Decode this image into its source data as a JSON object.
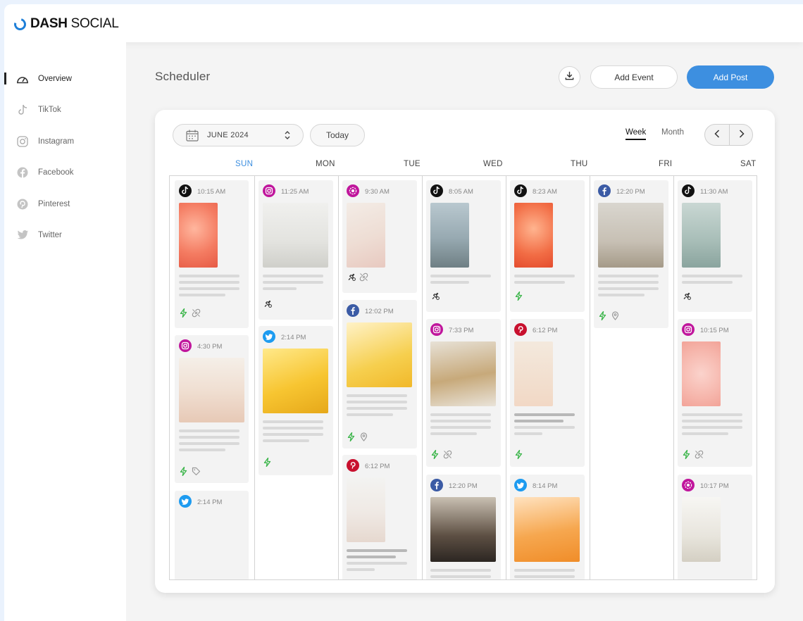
{
  "app": {
    "brand_bold": "DASH",
    "brand_light": "SOCIAL"
  },
  "sidebar": {
    "items": [
      {
        "label": "Overview",
        "icon": "dashboard-icon",
        "active": true
      },
      {
        "label": "TikTok",
        "icon": "tiktok-icon"
      },
      {
        "label": "Instagram",
        "icon": "instagram-icon"
      },
      {
        "label": "Facebook",
        "icon": "facebook-icon"
      },
      {
        "label": "Pinterest",
        "icon": "pinterest-icon"
      },
      {
        "label": "Twitter",
        "icon": "twitter-icon"
      }
    ]
  },
  "header": {
    "title": "Scheduler",
    "add_event": "Add Event",
    "add_post": "Add Post",
    "download_icon": "download-icon"
  },
  "calendar": {
    "month": "JUNE 2024",
    "today": "Today",
    "views": [
      "Week",
      "Month"
    ],
    "active_view": "Week",
    "days": [
      "SUN",
      "MON",
      "TUE",
      "WED",
      "THU",
      "FRI",
      "SAT"
    ],
    "active_day": "SUN",
    "columns": [
      [
        {
          "platform": "tiktok",
          "time": "10:15 AM",
          "actions": [
            "bolt",
            "link"
          ]
        },
        {
          "platform": "instagram",
          "time": "4:30 PM",
          "actions": [
            "bolt",
            "tag"
          ]
        },
        {
          "platform": "twitter",
          "time": "2:14 PM"
        }
      ],
      [
        {
          "platform": "instagram",
          "time": "11:25 AM",
          "actions": [
            "pin-alert"
          ]
        },
        {
          "platform": "twitter",
          "time": "2:14 PM",
          "actions": [
            "bolt"
          ]
        }
      ],
      [
        {
          "platform": "instagram-story",
          "time": "9:30 AM",
          "actions": [
            "pin-alert",
            "link"
          ]
        },
        {
          "platform": "facebook",
          "time": "12:02 PM",
          "actions": [
            "bolt",
            "location"
          ]
        },
        {
          "platform": "pinterest",
          "time": "6:12 PM"
        }
      ],
      [
        {
          "platform": "tiktok",
          "time": "8:05 AM",
          "actions": [
            "pin-alert"
          ]
        },
        {
          "platform": "instagram",
          "time": "7:33 PM",
          "actions": [
            "bolt",
            "link"
          ]
        },
        {
          "platform": "facebook",
          "time": "12:20 PM"
        }
      ],
      [
        {
          "platform": "tiktok",
          "time": "8:23 AM",
          "actions": [
            "bolt"
          ]
        },
        {
          "platform": "pinterest",
          "time": "6:12 PM",
          "actions": [
            "bolt"
          ]
        },
        {
          "platform": "twitter",
          "time": "8:14 PM"
        }
      ],
      [
        {
          "platform": "facebook",
          "time": "12:20 PM",
          "actions": [
            "bolt",
            "location"
          ]
        }
      ],
      [
        {
          "platform": "tiktok",
          "time": "11:30 AM",
          "actions": [
            "pin-alert"
          ]
        },
        {
          "platform": "instagram",
          "time": "10:15 PM",
          "actions": [
            "bolt",
            "link"
          ]
        },
        {
          "platform": "instagram-story",
          "time": "10:17 PM",
          "actions": [
            "pin-alert",
            "link"
          ]
        }
      ]
    ]
  },
  "colors": {
    "accent": "#3d8fe0",
    "tiktok": "#111111",
    "instagram": "#c0169c",
    "facebook": "#3b5ba5",
    "pinterest": "#c8102e",
    "twitter": "#1d9bf0",
    "action": "#3bb54a"
  }
}
